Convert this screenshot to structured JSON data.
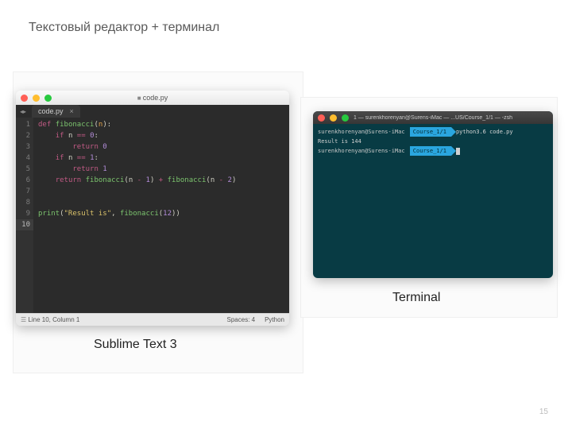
{
  "slide": {
    "title": "Текстовый редактор + терминал",
    "page_number": "15",
    "caption_sublime": "Sublime Text 3",
    "caption_terminal": "Terminal"
  },
  "sublime": {
    "window_title": "code.py",
    "tab_label": "code.py",
    "tab_close": "×",
    "nav_chevrons": "◂▸",
    "gutter": [
      "1",
      "2",
      "3",
      "4",
      "5",
      "6",
      "7",
      "8",
      "9",
      "10"
    ],
    "code": {
      "l1_kw": "def ",
      "l1_fn": "fibonacci",
      "l1_open": "(",
      "l1_arg": "n",
      "l1_close": "):",
      "l2_kw": "if ",
      "l2_a": "n ",
      "l2_op": "== ",
      "l2_n": "0",
      "l2_c": ":",
      "l3_kw": "return ",
      "l3_n": "0",
      "l4_kw": "if ",
      "l4_a": "n ",
      "l4_op": "== ",
      "l4_n": "1",
      "l4_c": ":",
      "l5_kw": "return ",
      "l5_n": "1",
      "l6_kw": "return ",
      "l6_f1": "fibonacci",
      "l6_p1": "(n ",
      "l6_op1": "- ",
      "l6_n1": "1",
      "l6_p2": ") ",
      "l6_plus": "+ ",
      "l6_f2": "fibonacci",
      "l6_p3": "(n ",
      "l6_op2": "- ",
      "l6_n2": "2",
      "l6_p4": ")",
      "l9_fn": "print",
      "l9_p": "(",
      "l9_s": "\"Result is\"",
      "l9_c": ", ",
      "l9_f": "fibonacci",
      "l9_p2": "(",
      "l9_n": "12",
      "l9_p3": "))"
    },
    "status": {
      "left": "Line 10, Column 1",
      "spaces": "Spaces: 4",
      "lang": "Python"
    }
  },
  "terminal": {
    "window_title": "1 — surenkhorenyan@Surens-iMac — ...US/Course_1/1 — -zsh",
    "line1_user": "surenkhorenyan@Surens-iMac ",
    "line1_seg": "Course_1/1",
    "line1_cmd": "python3.6 code.py",
    "line2": "Result is 144",
    "line3_user": "surenkhorenyan@Surens-iMac ",
    "line3_seg": "Course_1/1"
  }
}
